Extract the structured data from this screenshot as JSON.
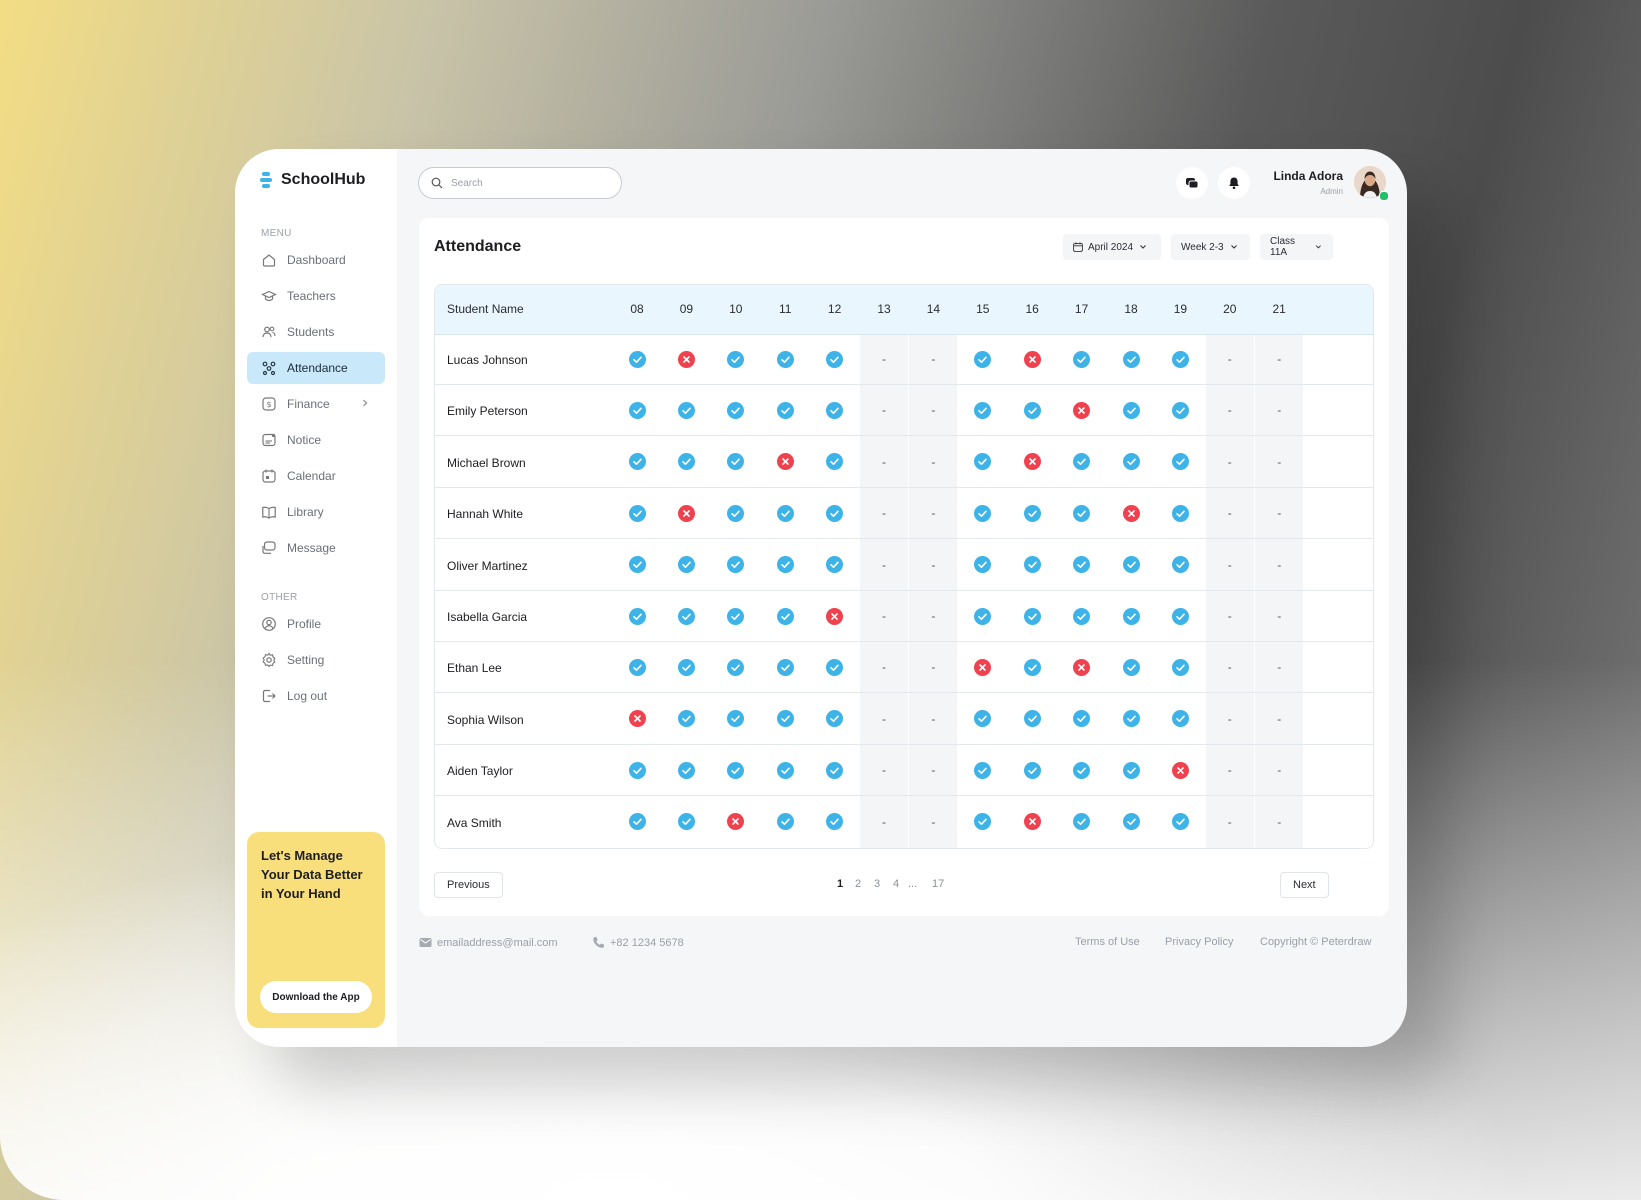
{
  "app": {
    "name": "SchoolHub"
  },
  "sidebar": {
    "menu_title": "MENU",
    "menu_items": [
      {
        "label": "Dashboard",
        "icon": "home-icon"
      },
      {
        "label": "Teachers",
        "icon": "graduation-cap-icon"
      },
      {
        "label": "Students",
        "icon": "users-icon"
      },
      {
        "label": "Attendance",
        "icon": "attendance-icon",
        "active": true
      },
      {
        "label": "Finance",
        "icon": "dollar-icon",
        "has_submenu": true
      },
      {
        "label": "Notice",
        "icon": "notice-icon"
      },
      {
        "label": "Calendar",
        "icon": "calendar-icon"
      },
      {
        "label": "Library",
        "icon": "book-icon"
      },
      {
        "label": "Message",
        "icon": "chat-icon"
      }
    ],
    "other_title": "OTHER",
    "other_items": [
      {
        "label": "Profile",
        "icon": "user-circle-icon"
      },
      {
        "label": "Setting",
        "icon": "gear-icon"
      },
      {
        "label": "Log out",
        "icon": "logout-icon"
      }
    ],
    "promo": {
      "title": "Let's Manage Your Data Better in Your Hand",
      "button": "Download the App"
    }
  },
  "topbar": {
    "search_placeholder": "Search",
    "user_name": "Linda Adora",
    "user_role": "Admin"
  },
  "attendance": {
    "title": "Attendance",
    "filters": {
      "month": "April 2024",
      "week": "Week 2-3",
      "class": "Class 11A"
    },
    "columns": {
      "name": "Student Name",
      "days": [
        "08",
        "09",
        "10",
        "11",
        "12",
        "13",
        "14",
        "15",
        "16",
        "17",
        "18",
        "19",
        "20",
        "21"
      ]
    },
    "weekend_days": [
      "13",
      "14",
      "20",
      "21"
    ],
    "rows": [
      {
        "name": "Lucas Johnson",
        "marks": [
          "P",
          "A",
          "P",
          "P",
          "P",
          "-",
          "-",
          "P",
          "A",
          "P",
          "P",
          "P",
          "-",
          "-"
        ]
      },
      {
        "name": "Emily Peterson",
        "marks": [
          "P",
          "P",
          "P",
          "P",
          "P",
          "-",
          "-",
          "P",
          "P",
          "A",
          "P",
          "P",
          "-",
          "-"
        ]
      },
      {
        "name": "Michael Brown",
        "marks": [
          "P",
          "P",
          "P",
          "A",
          "P",
          "-",
          "-",
          "P",
          "A",
          "P",
          "P",
          "P",
          "-",
          "-"
        ]
      },
      {
        "name": "Hannah White",
        "marks": [
          "P",
          "A",
          "P",
          "P",
          "P",
          "-",
          "-",
          "P",
          "P",
          "P",
          "A",
          "P",
          "-",
          "-"
        ]
      },
      {
        "name": "Oliver Martinez",
        "marks": [
          "P",
          "P",
          "P",
          "P",
          "P",
          "-",
          "-",
          "P",
          "P",
          "P",
          "P",
          "P",
          "-",
          "-"
        ]
      },
      {
        "name": "Isabella Garcia",
        "marks": [
          "P",
          "P",
          "P",
          "P",
          "A",
          "-",
          "-",
          "P",
          "P",
          "P",
          "P",
          "P",
          "-",
          "-"
        ]
      },
      {
        "name": "Ethan Lee",
        "marks": [
          "P",
          "P",
          "P",
          "P",
          "P",
          "-",
          "-",
          "A",
          "P",
          "A",
          "P",
          "P",
          "-",
          "-"
        ]
      },
      {
        "name": "Sophia Wilson",
        "marks": [
          "A",
          "P",
          "P",
          "P",
          "P",
          "-",
          "-",
          "P",
          "P",
          "P",
          "P",
          "P",
          "-",
          "-"
        ]
      },
      {
        "name": "Aiden Taylor",
        "marks": [
          "P",
          "P",
          "P",
          "P",
          "P",
          "-",
          "-",
          "P",
          "P",
          "P",
          "P",
          "A",
          "-",
          "-"
        ]
      },
      {
        "name": "Ava Smith",
        "marks": [
          "P",
          "P",
          "A",
          "P",
          "P",
          "-",
          "-",
          "P",
          "A",
          "P",
          "P",
          "P",
          "-",
          "-"
        ]
      }
    ],
    "pagination": {
      "previous": "Previous",
      "next": "Next",
      "pages": [
        "1",
        "2",
        "3",
        "4",
        "...",
        "17"
      ],
      "current": "1"
    }
  },
  "footer": {
    "email": "emailaddress@mail.com",
    "phone": "+82 1234 5678",
    "terms": "Terms of Use",
    "privacy": "Privacy Policy",
    "copyright": "Copyright © Peterdraw"
  },
  "colors": {
    "present": "#3db3e8",
    "absent": "#f0414f",
    "active_nav": "#c9e9fb",
    "promo": "#f9df7b",
    "table_header": "#eaf6fd"
  }
}
